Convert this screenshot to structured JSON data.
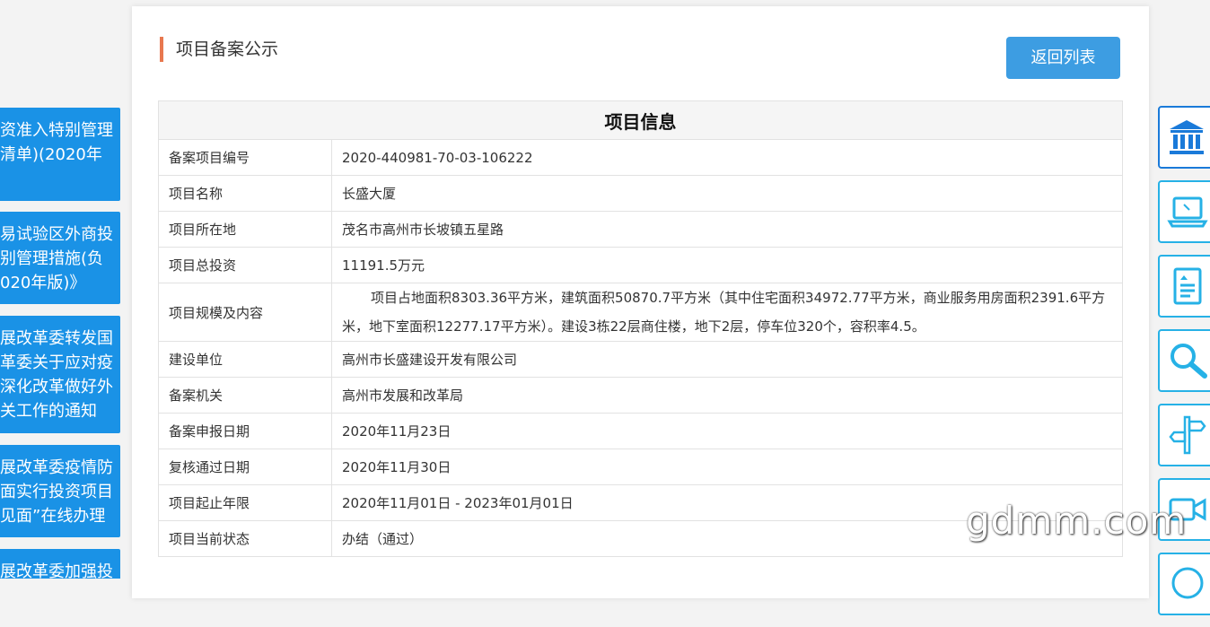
{
  "left_banners": [
    {
      "lines": [
        "资准入特别管理",
        "清单)(2020年"
      ]
    },
    {
      "lines": [
        "易试验区外商投",
        "别管理措施(负",
        "020年版)》"
      ]
    },
    {
      "lines": [
        "展改革委转发国",
        "革委关于应对疫",
        "深化改革做好外",
        "关工作的通知"
      ]
    },
    {
      "lines": [
        "展改革委疫情防",
        "面实行投资项目",
        "见面”在线办理"
      ]
    },
    {
      "lines": [
        "展改革委加强投"
      ]
    }
  ],
  "header": {
    "title": "项目备案公示",
    "back_button": "返回列表"
  },
  "table": {
    "caption": "项目信息",
    "rows": [
      {
        "label": "备案项目编号",
        "value": "2020-440981-70-03-106222"
      },
      {
        "label": "项目名称",
        "value": "长盛大厦"
      },
      {
        "label": "项目所在地",
        "value": "茂名市高州市长坡镇五星路"
      },
      {
        "label": "项目总投资",
        "value": "11191.5万元"
      },
      {
        "label": "项目规模及内容",
        "value": "项目占地面积8303.36平方米，建筑面积50870.7平方米（其中住宅面积34972.77平方米，商业服务用房面积2391.6平方米，地下室面积12277.17平方米）。建设3栋22层商住楼，地下2层，停车位320个，容积率4.5。"
      },
      {
        "label": "建设单位",
        "value": "高州市长盛建设开发有限公司"
      },
      {
        "label": "备案机关",
        "value": "高州市发展和改革局"
      },
      {
        "label": "备案申报日期",
        "value": "2020年11月23日"
      },
      {
        "label": "复核通过日期",
        "value": "2020年11月30日"
      },
      {
        "label": "项目起止年限",
        "value": "2020年11月01日 - 2023年01月01日"
      },
      {
        "label": "项目当前状态",
        "value": "办结（通过）"
      }
    ]
  },
  "side_icons": [
    "bank-icon",
    "laptop-icon",
    "document-icon",
    "magnifier-icon",
    "signpost-icon",
    "video-camera-icon",
    "chat-icon"
  ],
  "colors": {
    "accent_blue": "#3d9de2",
    "banner_blue": "#1a92e6",
    "title_bar_orange": "#e8784f",
    "side_border": "#26b1e6"
  },
  "watermark": "gdmm.com"
}
